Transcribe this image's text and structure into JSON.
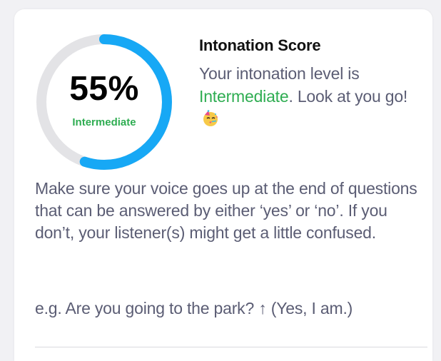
{
  "score": {
    "percent_label": "55%",
    "progress": 0.55,
    "level": "Intermediate",
    "colors": {
      "ring_track": "#e3e3e6",
      "ring_fill": "#17a8f5",
      "level_green": "#2fad52"
    }
  },
  "summary": {
    "title": "Intonation Score",
    "line_prefix": "Your intonation level is ",
    "level_highlight": "Intermediate",
    "line_suffix": ". Look at you go!",
    "emoji_icon": "party-face-icon"
  },
  "tip": {
    "text": "Make sure your voice goes up at the end of questions that can be answered by either ‘yes’ or ‘no’. If you don’t, your listener(s) might get a little confused."
  },
  "example": {
    "text": "e.g. Are you going to the park? ↑ (Yes, I am.)"
  }
}
